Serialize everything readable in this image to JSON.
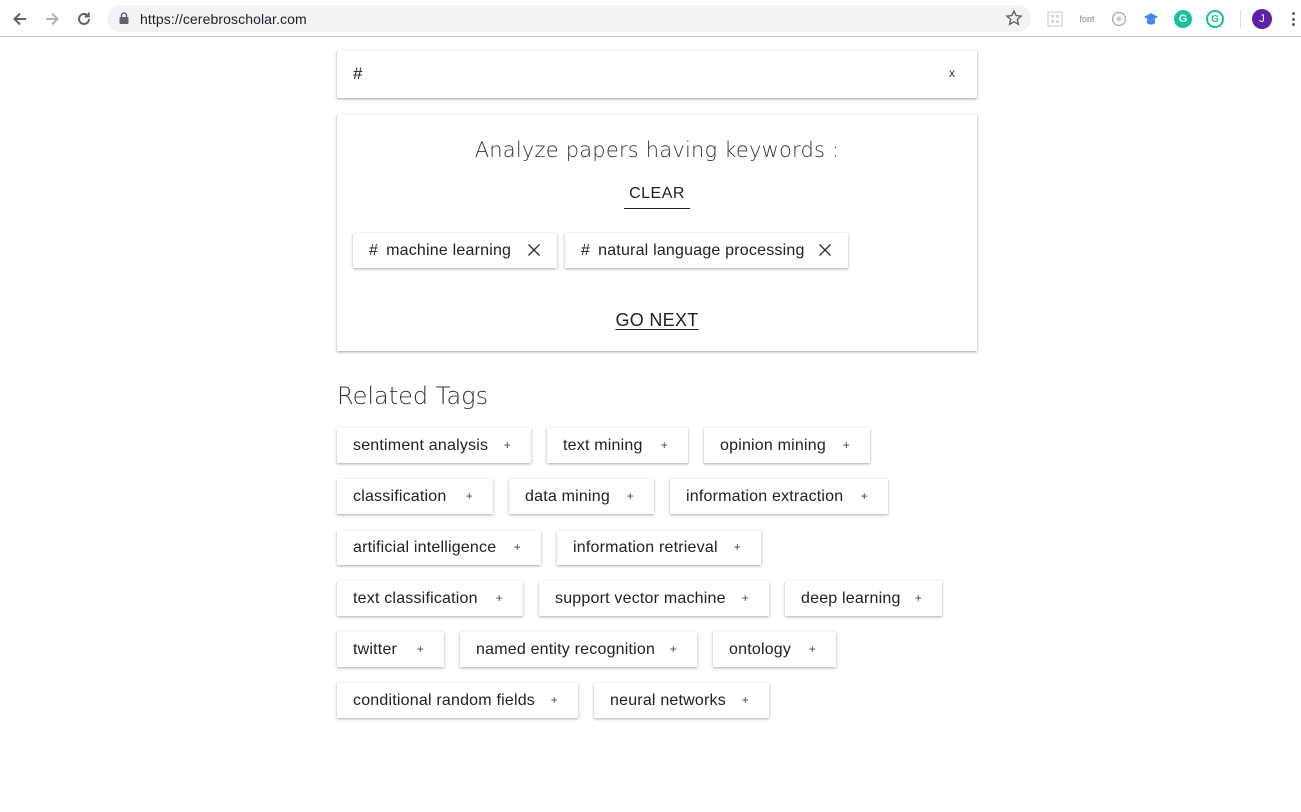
{
  "browser": {
    "url": "https://cerebroscholar.com",
    "extensions": [
      "font"
    ],
    "profile_initial": "J"
  },
  "search": {
    "value": "#",
    "clear_label": "x"
  },
  "analyze": {
    "title": "Analyze papers having keywords :",
    "clear_label": "CLEAR",
    "keywords": [
      {
        "hash": "#",
        "label": "machine learning"
      },
      {
        "hash": "#",
        "label": "natural language processing"
      }
    ],
    "go_next_label": "GO NEXT"
  },
  "related": {
    "title": "Related Tags",
    "plus": "+",
    "tags": [
      "sentiment analysis",
      "text mining",
      "opinion mining",
      "classification",
      "data mining",
      "information extraction",
      "artificial intelligence",
      "information retrieval",
      "text classification",
      "support vector machine",
      "deep learning",
      "twitter",
      "named entity recognition",
      "ontology",
      "conditional random fields",
      "neural networks"
    ]
  }
}
